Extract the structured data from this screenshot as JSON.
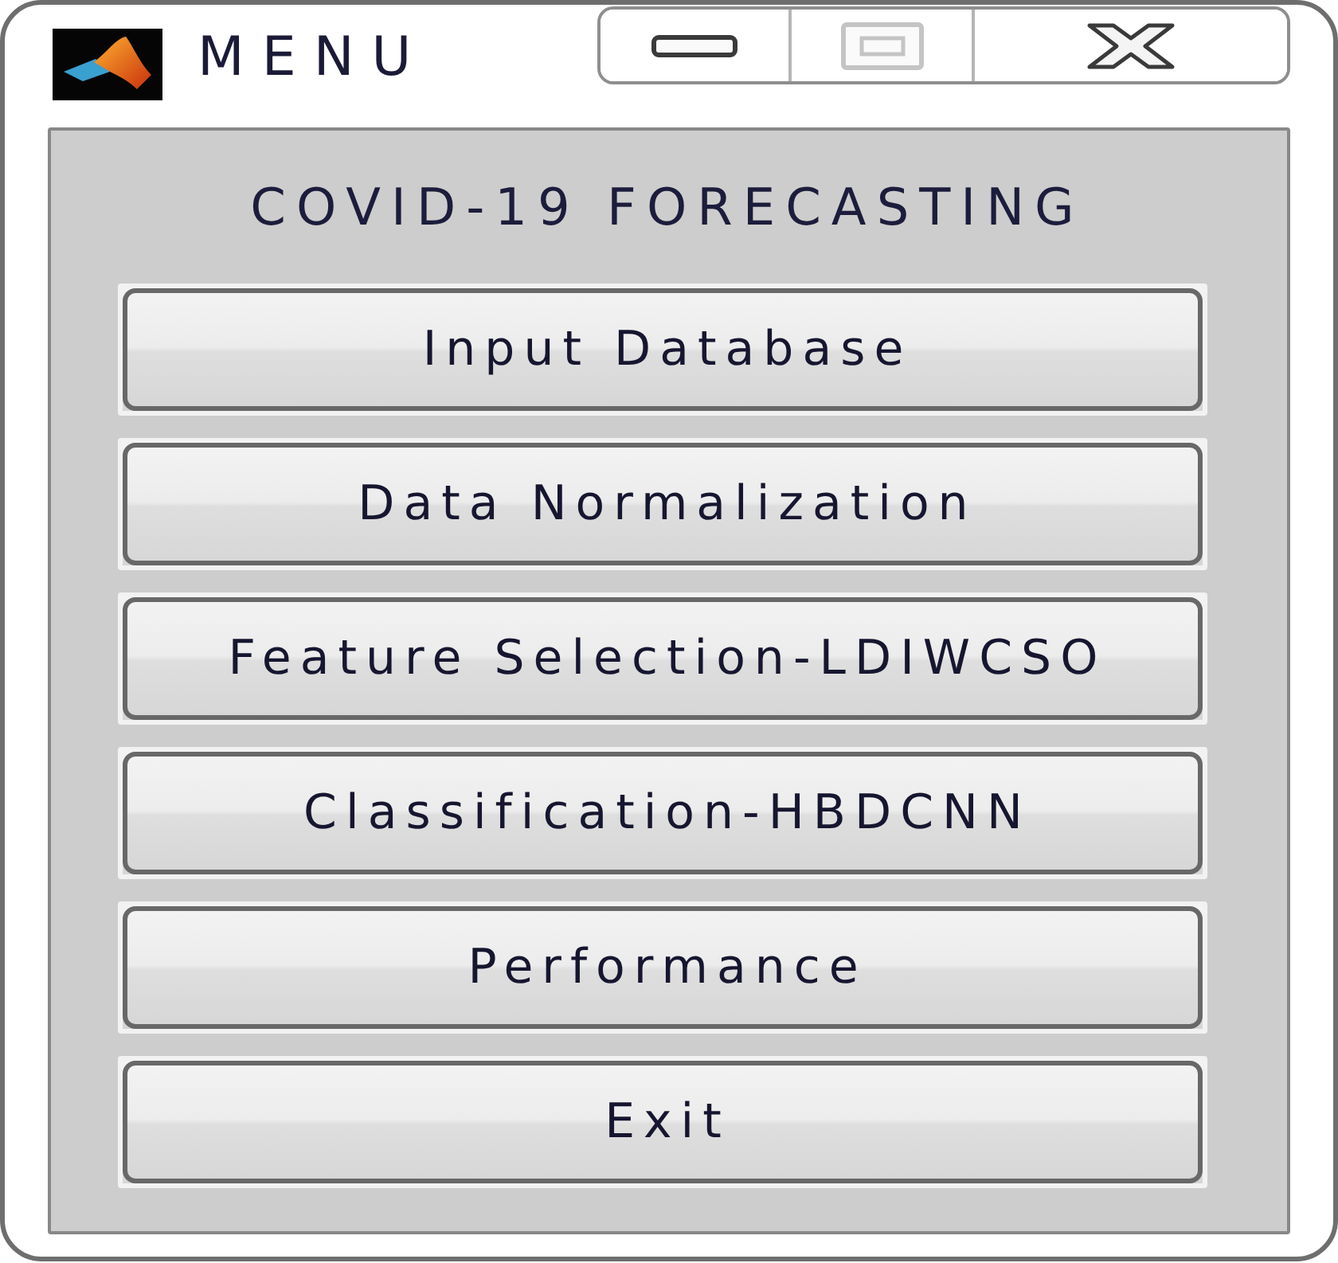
{
  "window": {
    "title": "MENU",
    "controls": [
      {
        "kind": "minimize",
        "disabled": false
      },
      {
        "kind": "maximize",
        "disabled": true
      },
      {
        "kind": "close",
        "disabled": false
      }
    ]
  },
  "panel": {
    "heading": "COVID-19 FORECASTING",
    "buttons": [
      "Input Database",
      "Data Normalization",
      "Feature Selection-LDIWCSO",
      "Classification-HBDCNN",
      "Performance",
      "Exit"
    ]
  }
}
